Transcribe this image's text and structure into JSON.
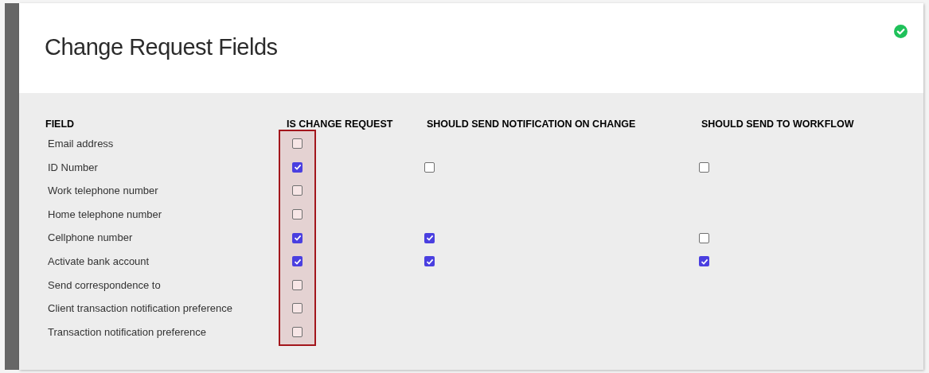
{
  "title": "Change Request Fields",
  "status": {
    "kind": "success"
  },
  "columns": [
    {
      "label": "FIELD",
      "kind": "label"
    },
    {
      "label": "IS CHANGE REQUEST",
      "kind": "check",
      "highlighted": true
    },
    {
      "label": "SHOULD SEND NOTIFICATION ON CHANGE",
      "kind": "check",
      "highlighted": false
    },
    {
      "label": "SHOULD SEND TO WORKFLOW",
      "kind": "check",
      "highlighted": false
    }
  ],
  "rows": [
    {
      "field": "Email address",
      "checks": [
        {
          "checked": false
        }
      ]
    },
    {
      "field": "ID Number",
      "checks": [
        {
          "checked": true
        },
        {
          "checked": false
        },
        {
          "checked": false
        }
      ]
    },
    {
      "field": "Work telephone number",
      "checks": [
        {
          "checked": false
        }
      ]
    },
    {
      "field": "Home telephone number",
      "checks": [
        {
          "checked": false
        }
      ]
    },
    {
      "field": "Cellphone number",
      "checks": [
        {
          "checked": true
        },
        {
          "checked": true
        },
        {
          "checked": false
        }
      ]
    },
    {
      "field": "Activate bank account",
      "checks": [
        {
          "checked": true
        },
        {
          "checked": true
        },
        {
          "checked": true
        }
      ]
    },
    {
      "field": "Send correspondence to",
      "checks": [
        {
          "checked": false
        }
      ]
    },
    {
      "field": "Client transaction notification preference",
      "checks": [
        {
          "checked": false
        }
      ]
    },
    {
      "field": "Transaction notification preference",
      "checks": [
        {
          "checked": false
        }
      ]
    }
  ]
}
